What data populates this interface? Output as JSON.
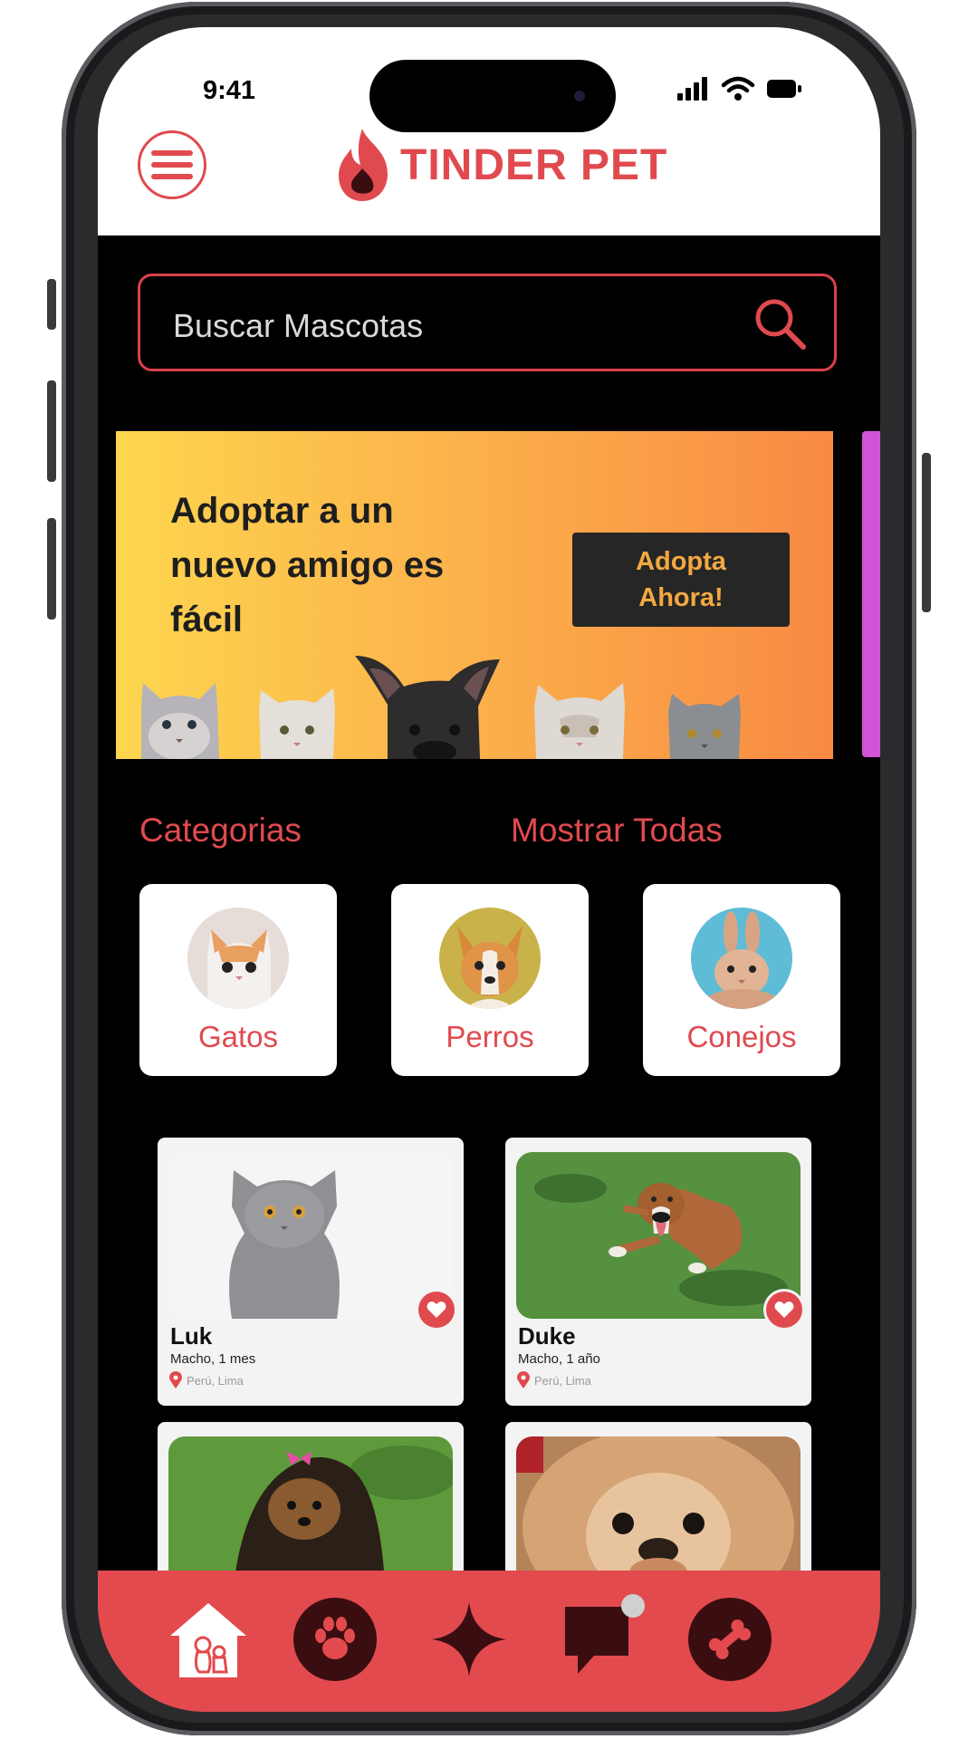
{
  "status": {
    "time": "9:41"
  },
  "header": {
    "app_name": "TINDER PET"
  },
  "search": {
    "placeholder": "Buscar Mascotas"
  },
  "banner": {
    "title": "Adoptar a un nuevo amigo es fácil",
    "button_label": "Adopta Ahora!"
  },
  "categories": {
    "title": "Categorias",
    "show_all": "Mostrar Todas",
    "items": [
      {
        "label": "Gatos"
      },
      {
        "label": "Perros"
      },
      {
        "label": "Conejos"
      }
    ]
  },
  "pets": [
    {
      "name": "Luk",
      "info": "Macho, 1 mes",
      "location": "Perú, Lima"
    },
    {
      "name": "Duke",
      "info": "Macho, 1 año",
      "location": "Perú, Lima"
    }
  ],
  "nav": {
    "items": [
      {
        "icon": "home-icon"
      },
      {
        "icon": "paw-icon"
      },
      {
        "icon": "sparkle-icon"
      },
      {
        "icon": "chat-icon"
      },
      {
        "icon": "bone-icon"
      }
    ]
  },
  "colors": {
    "accent": "#e04a4f",
    "nav_bg": "#e24a4e",
    "banner_start": "#fdd64e",
    "banner_end": "#f88a43",
    "scroll": "#d254d6"
  }
}
